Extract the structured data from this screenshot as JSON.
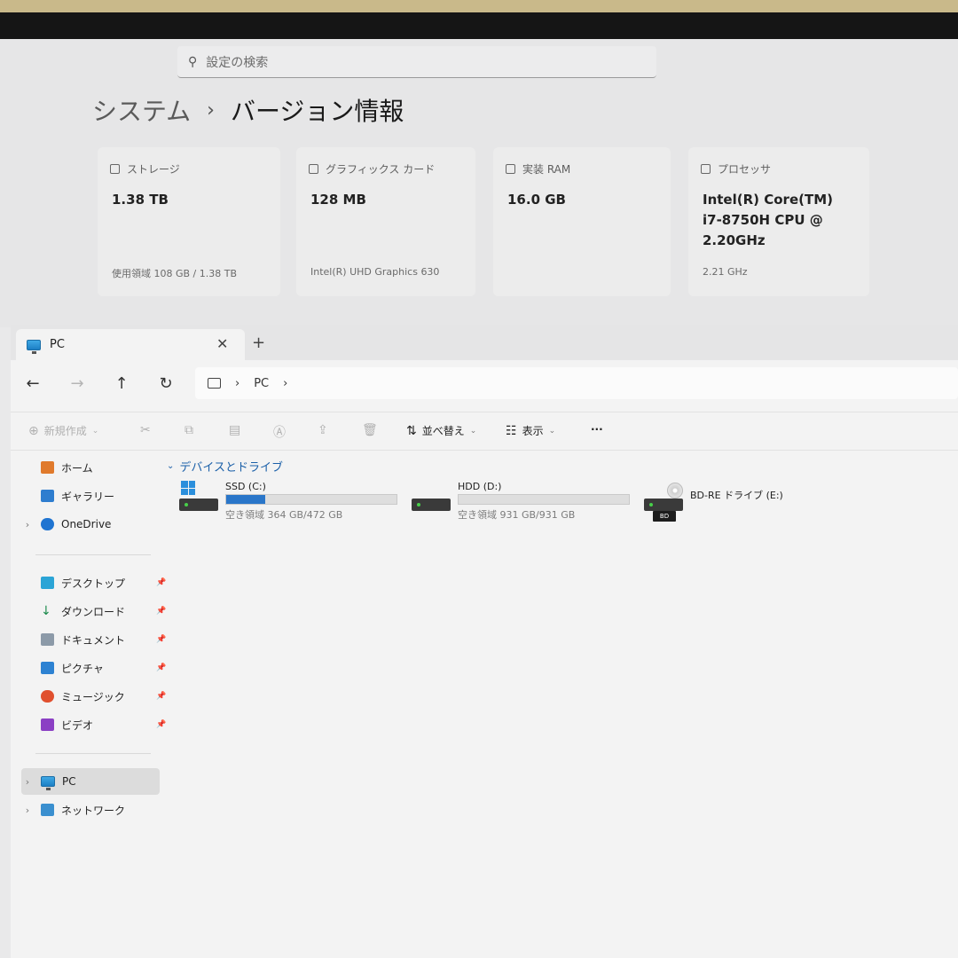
{
  "settings": {
    "search_placeholder": "設定の検索",
    "breadcrumb": {
      "parent": "システム",
      "separator": "›",
      "current": "バージョン情報"
    },
    "cards": [
      {
        "title": "ストレージ",
        "value": "1.38 TB",
        "sub": "使用領域 108 GB / 1.38 TB"
      },
      {
        "title": "グラフィックス カード",
        "value": "128 MB",
        "sub": "Intel(R) UHD Graphics 630"
      },
      {
        "title": "実装 RAM",
        "value": "16.0 GB",
        "sub": ""
      },
      {
        "title": "プロセッサ",
        "value": "Intel(R) Core(TM) i7-8750H CPU @ 2.20GHz",
        "sub": "2.21 GHz"
      }
    ]
  },
  "explorer": {
    "tab": {
      "title": "PC",
      "close": "✕",
      "new_tab": "+"
    },
    "nav": {
      "back": "←",
      "forward": "→",
      "up": "↑",
      "refresh": "↻"
    },
    "address": {
      "location": "PC",
      "sep": "›"
    },
    "toolbar": {
      "new_label": "新規作成",
      "sort_label": "並べ替え",
      "view_label": "表示",
      "more_label": "···"
    },
    "sidebar": {
      "home": "ホーム",
      "gallery": "ギャラリー",
      "onedrive": "OneDrive",
      "quick_access": [
        "デスクトップ",
        "ダウンロード",
        "ドキュメント",
        "ピクチャ",
        "ミュージック",
        "ビデオ"
      ],
      "pc": "PC",
      "network": "ネットワーク"
    },
    "group_header": "デバイスとドライブ",
    "drives": [
      {
        "name": "SSD (C:)",
        "free_text": "空き領域 364 GB/472 GB",
        "used_fraction": 0.229
      },
      {
        "name": "HDD (D:)",
        "free_text": "空き領域 931 GB/931 GB",
        "used_fraction": 0.0
      },
      {
        "name": "BD-RE ドライブ (E:)",
        "badge": "BD"
      }
    ]
  }
}
